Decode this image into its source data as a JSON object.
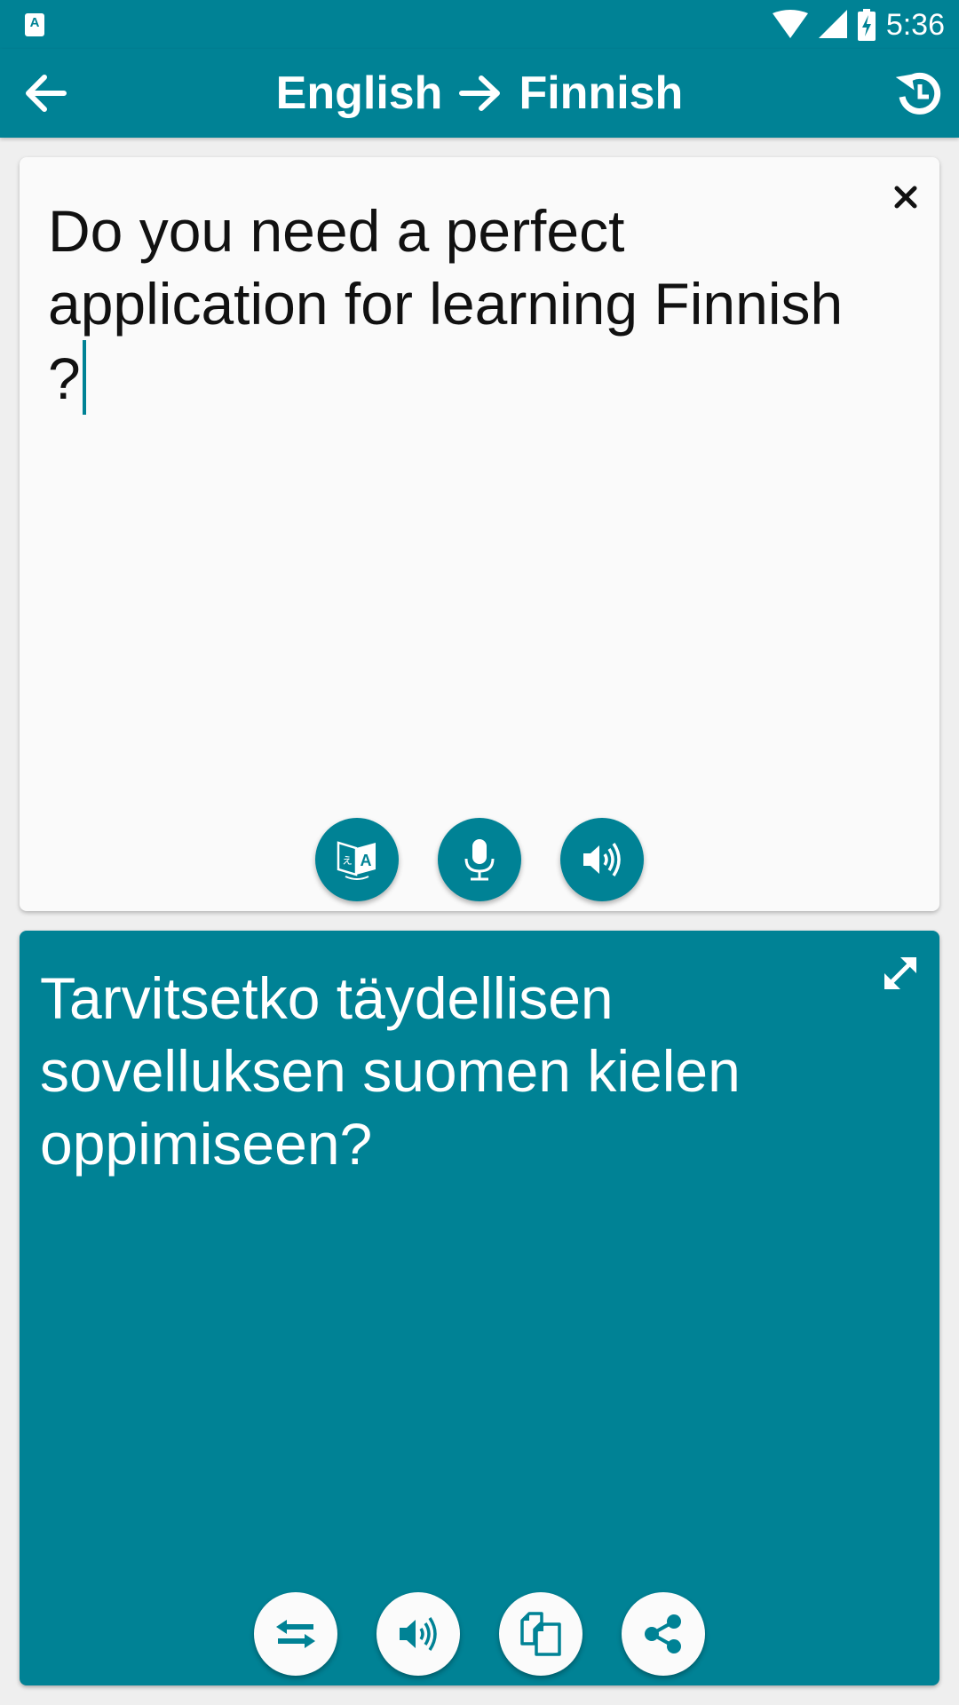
{
  "status_bar": {
    "notification_icon": "translate-notification-icon",
    "icons": [
      "wifi-icon",
      "cell-signal-icon",
      "battery-charging-icon"
    ],
    "time": "5:36"
  },
  "app_bar": {
    "back_icon": "arrow-left-icon",
    "source_language": "English",
    "arrow_icon": "arrow-right-icon",
    "target_language": "Finnish",
    "history_icon": "history-icon"
  },
  "input_card": {
    "text": "Do you need a perfect application for learning Finnish ?",
    "clear_icon": "close-icon",
    "buttons": [
      {
        "name": "translate-button",
        "icon": "translate-icon"
      },
      {
        "name": "microphone-button",
        "icon": "microphone-icon"
      },
      {
        "name": "speak-input-button",
        "icon": "speaker-icon"
      }
    ]
  },
  "output_card": {
    "text": "Tarvitsetko täydellisen sovelluksen suomen kielen oppimiseen?",
    "expand_icon": "expand-icon",
    "buttons": [
      {
        "name": "swap-languages-button",
        "icon": "swap-icon"
      },
      {
        "name": "speak-output-button",
        "icon": "speaker-icon"
      },
      {
        "name": "copy-button",
        "icon": "copy-icon"
      },
      {
        "name": "share-button",
        "icon": "share-icon"
      }
    ]
  },
  "colors": {
    "primary": "#008295",
    "background": "#efefef",
    "input_card": "#fafafa",
    "text_dark": "#111111",
    "text_light": "#ffffff"
  }
}
